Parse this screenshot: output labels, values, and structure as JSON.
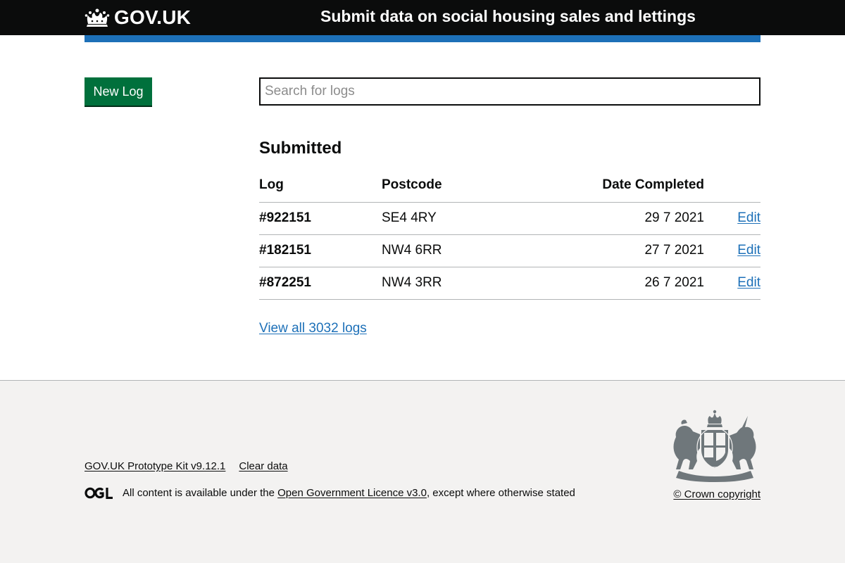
{
  "header": {
    "logo_text": "GOV.UK",
    "service_name": "Submit data on social housing sales and lettings"
  },
  "actions": {
    "new_log_label": "New Log"
  },
  "search": {
    "placeholder": "Search for logs",
    "value": ""
  },
  "section": {
    "title": "Submitted"
  },
  "table": {
    "headers": {
      "log": "Log",
      "postcode": "Postcode",
      "date_completed": "Date Completed"
    },
    "rows": [
      {
        "log": "#922151",
        "postcode": "SE4 4RY",
        "date": "29 7 2021",
        "action": "Edit"
      },
      {
        "log": "#182151",
        "postcode": "NW4 6RR",
        "date": "27 7 2021",
        "action": "Edit"
      },
      {
        "log": "#872251",
        "postcode": "NW4 3RR",
        "date": "26 7 2021",
        "action": "Edit"
      }
    ]
  },
  "view_all_label": "View all 3032 logs",
  "footer": {
    "links": [
      "GOV.UK Prototype Kit v9.12.1",
      "Clear data"
    ],
    "licence_prefix": "All content is available under the ",
    "licence_link": "Open Government Licence v3.0",
    "licence_suffix": ", except where otherwise stated",
    "copyright": "© Crown copyright"
  },
  "colors": {
    "header_bg": "#0b0c0c",
    "brand_blue": "#1d70b8",
    "button_green": "#00703c",
    "footer_bg": "#f3f2f1",
    "link_blue": "#1d70b8"
  },
  "icons": {
    "logo": "crown-icon",
    "licence": "ogl-logo-icon",
    "crest": "royal-coat-of-arms-icon"
  }
}
